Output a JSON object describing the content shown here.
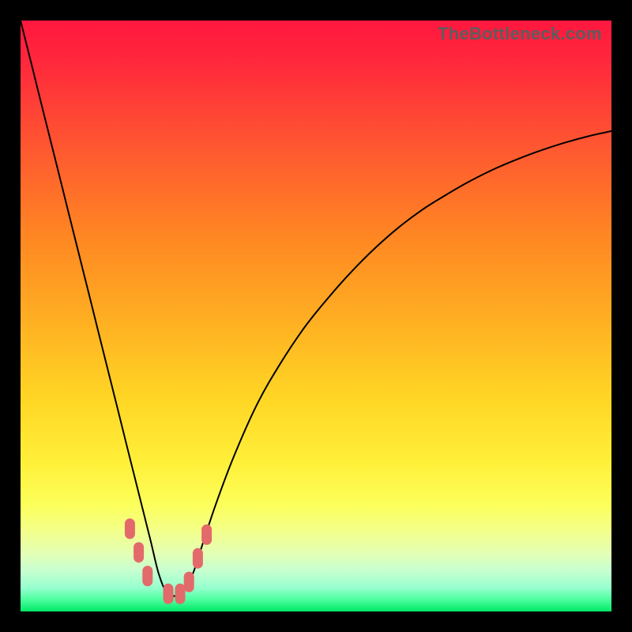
{
  "watermark": "TheBottleneck.com",
  "colors": {
    "background": "#000000",
    "gradient_top": "#ff173f",
    "gradient_bottom": "#00e866",
    "curve": "#000000",
    "marker": "#e36a6a"
  },
  "chart_data": {
    "type": "line",
    "title": "",
    "xlabel": "",
    "ylabel": "",
    "xlim": [
      0,
      100
    ],
    "ylim": [
      0,
      100
    ],
    "x": [
      0,
      2,
      4,
      6,
      8,
      10,
      12,
      14,
      16,
      18,
      20,
      22,
      23.5,
      25,
      27,
      29,
      31,
      33,
      36,
      40,
      44,
      48,
      52,
      56,
      60,
      64,
      68,
      72,
      76,
      80,
      84,
      88,
      92,
      96,
      100
    ],
    "values": [
      100,
      92,
      84,
      76,
      68,
      60,
      52,
      44,
      36,
      28,
      20,
      12,
      6,
      3,
      3,
      6,
      12,
      18,
      26,
      35,
      42,
      48,
      53,
      57.5,
      61.5,
      65,
      68,
      70.5,
      72.8,
      74.8,
      76.5,
      78,
      79.3,
      80.4,
      81.3
    ],
    "markers_x": [
      18.5,
      20,
      21.5,
      25,
      27,
      28.5,
      30,
      31.5
    ],
    "markers_y": [
      14,
      10,
      6,
      3,
      3,
      5,
      9,
      13
    ]
  }
}
